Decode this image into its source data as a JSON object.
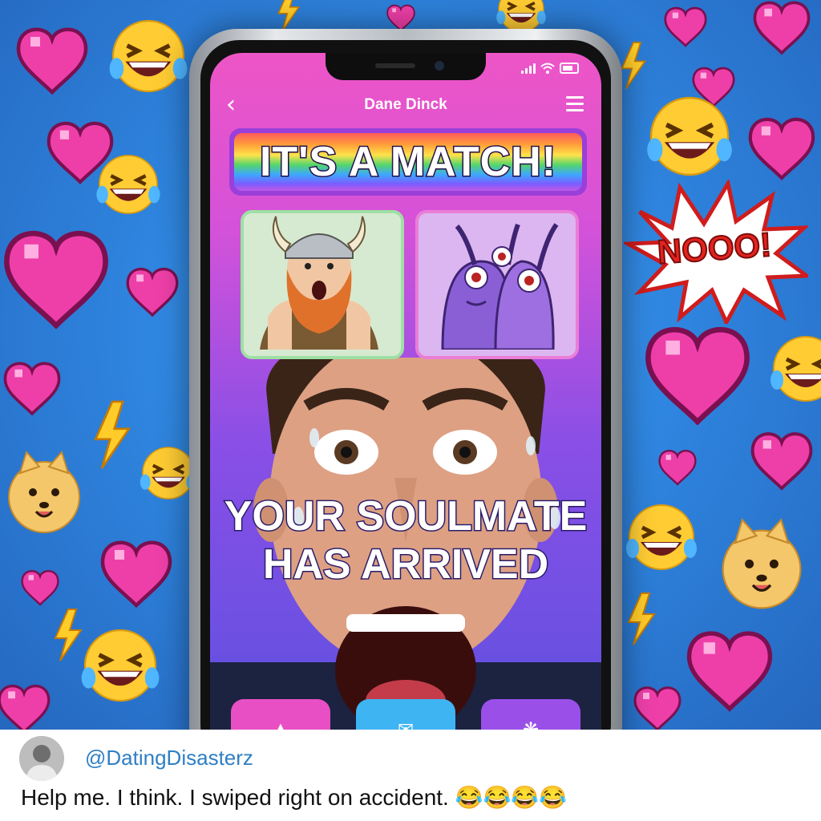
{
  "app": {
    "title": "Dane Dinck",
    "back_icon": "chevron-left-icon",
    "menu_icon": "hamburger-menu-icon"
  },
  "match_banner": "IT'S A MATCH!",
  "cards": [
    {
      "name": "viking-cartoon",
      "bg": "#d6ead1"
    },
    {
      "name": "alien-cartoon",
      "bg": "#dcb6f0"
    }
  ],
  "caption": {
    "line1": "YOUR SOULMATE",
    "line2": "HAS ARRIVED"
  },
  "action_buttons": [
    {
      "icon": "arrow-up-icon",
      "color": "#e84fc4"
    },
    {
      "icon": "message-icon",
      "color": "#3fb4f3"
    },
    {
      "icon": "puzzle-icon",
      "color": "#9a4fe8"
    }
  ],
  "burst": "NOOO!",
  "tweet": {
    "handle": "@DatingDisasterz",
    "text": "Help me. I think. I swiped right on accident. 😂😂😂😂"
  },
  "colors": {
    "screen_top": "#ee55c6",
    "screen_bottom": "#5b50e0",
    "handle": "#2f7fc4",
    "burst_text": "#e3231e"
  }
}
